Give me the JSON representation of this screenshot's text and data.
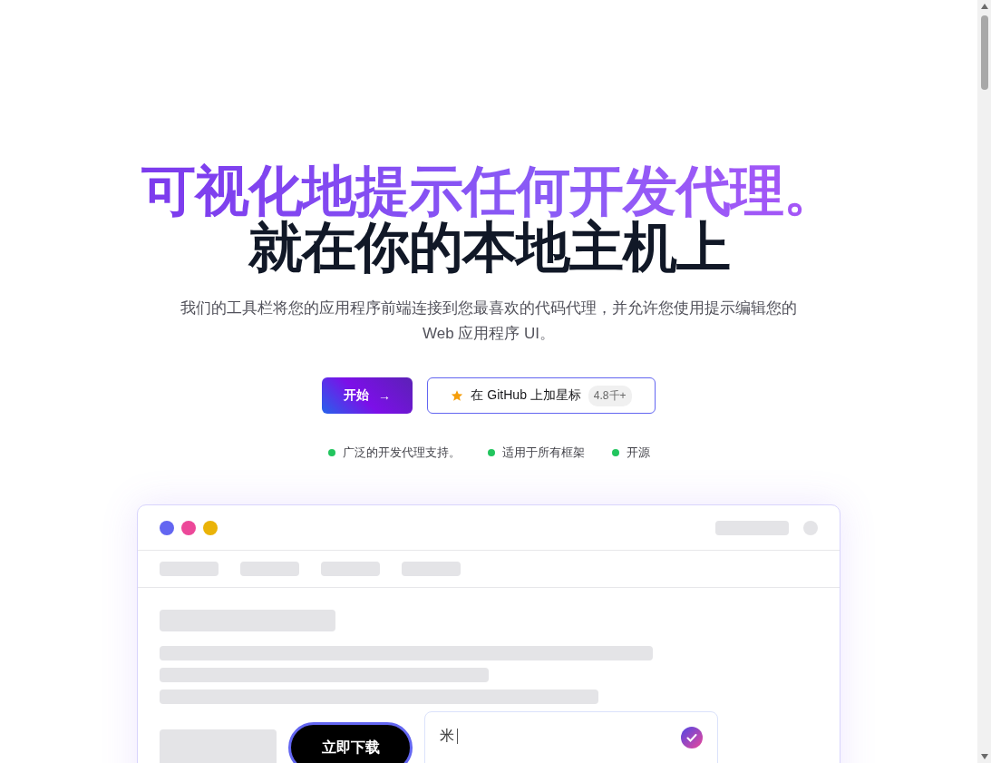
{
  "hero": {
    "title_line_1": "可视化地提示任何开发代理。",
    "title_line_2": "就在你的本地主机上",
    "subtitle": "我们的工具栏将您的应用程序前端连接到您最喜欢的代码代理，并允许您使用提示编辑您的 Web 应用程序 UI。"
  },
  "buttons": {
    "primary": {
      "label": "开始",
      "icon": "→"
    },
    "secondary": {
      "label": "在 GitHub 上加星标",
      "badge": "4.8千+"
    }
  },
  "features": [
    {
      "label": "广泛的开发代理支持。",
      "color": "#22c55e"
    },
    {
      "label": "适用于所有框架",
      "color": "#22c55e"
    },
    {
      "label": "开源",
      "color": "#22c55e"
    }
  ],
  "mockup": {
    "window_dots": [
      {
        "color": "#6366f1"
      },
      {
        "color": "#ec4899"
      },
      {
        "color": "#eab308"
      }
    ],
    "download_button": {
      "label": "立即下载"
    },
    "prompt_input": {
      "value": "米"
    }
  }
}
